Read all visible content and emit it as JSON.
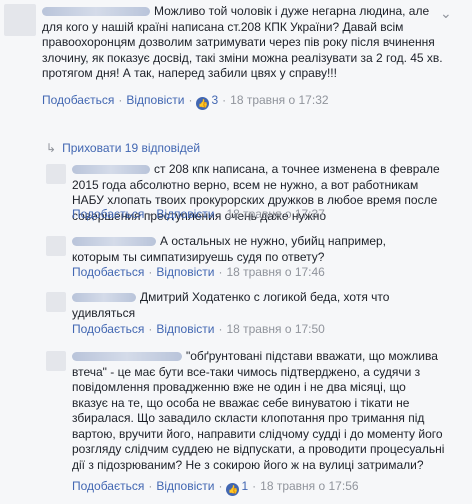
{
  "main_comment": {
    "text_lines": [
      "Можливо той чоловік і дуже негарна людина, але",
      "для кого у нашій країні написана ст.208 КПК України? Давай всім",
      "правоохоронцям дозволим затримувати через пів року після вчинення",
      "злочину, як показує досвід, такі зміни можна реалізувати за 2 год. 45 хв.",
      "протягом дня! А так, наперед забили цвях у справу!!!"
    ],
    "like_label": "Подобається",
    "reply_label": "Відповісти",
    "like_count": "3",
    "timestamp": "18 травня о 17:32"
  },
  "hide_replies": {
    "label": "Приховати 19 відповідей"
  },
  "replies": [
    {
      "text_lines": [
        "ст 208 кпк написана, а точнее изменена в феврале",
        "2015 года абсолютно верно, всем не нужно, а вот работникам",
        "НАБУ хлопать твоих прокурорских дружков в любое время после",
        "совершения преступления очень даже нужно"
      ],
      "like_label": "Подобається",
      "reply_label": "Відповісти",
      "timestamp": "18 травня о 17:37"
    },
    {
      "text_lines": [
        "А остальных не нужно, убийц например,",
        "которым ты симпатизируешь судя по ответу?"
      ],
      "like_label": "Подобається",
      "reply_label": "Відповісти",
      "timestamp": "18 травня о 17:46"
    },
    {
      "text_lines": [
        "Дмитрий Ходатенко с логикой беда, хотя что",
        "удивляться"
      ],
      "like_label": "Подобається",
      "reply_label": "Відповісти",
      "timestamp": "18 травня о 17:50"
    },
    {
      "text_lines": [
        "\"обґрунтовані підстави вважати, що можлива",
        "втеча\" - це має бути все-таки чимось підтверджено, а судячи з",
        "повідомлення провадженню вже не один і не два місяці, що",
        "вказує на те, що особа не вважає себе винуватою і тікати не",
        "збиралася. Що завадило скласти клопотання про тримання під",
        "вартою, вручити його, направити слідчому судді і до моменту його",
        "розгляду слідчим суддею не відпускати, а проводити процесуальні",
        "дії з підозрюваним? Не з сокирою його ж на вулиці затримали?"
      ],
      "like_label": "Подобається",
      "reply_label": "Відповісти",
      "like_count": "1",
      "timestamp": "18 травня о 17:56"
    }
  ]
}
